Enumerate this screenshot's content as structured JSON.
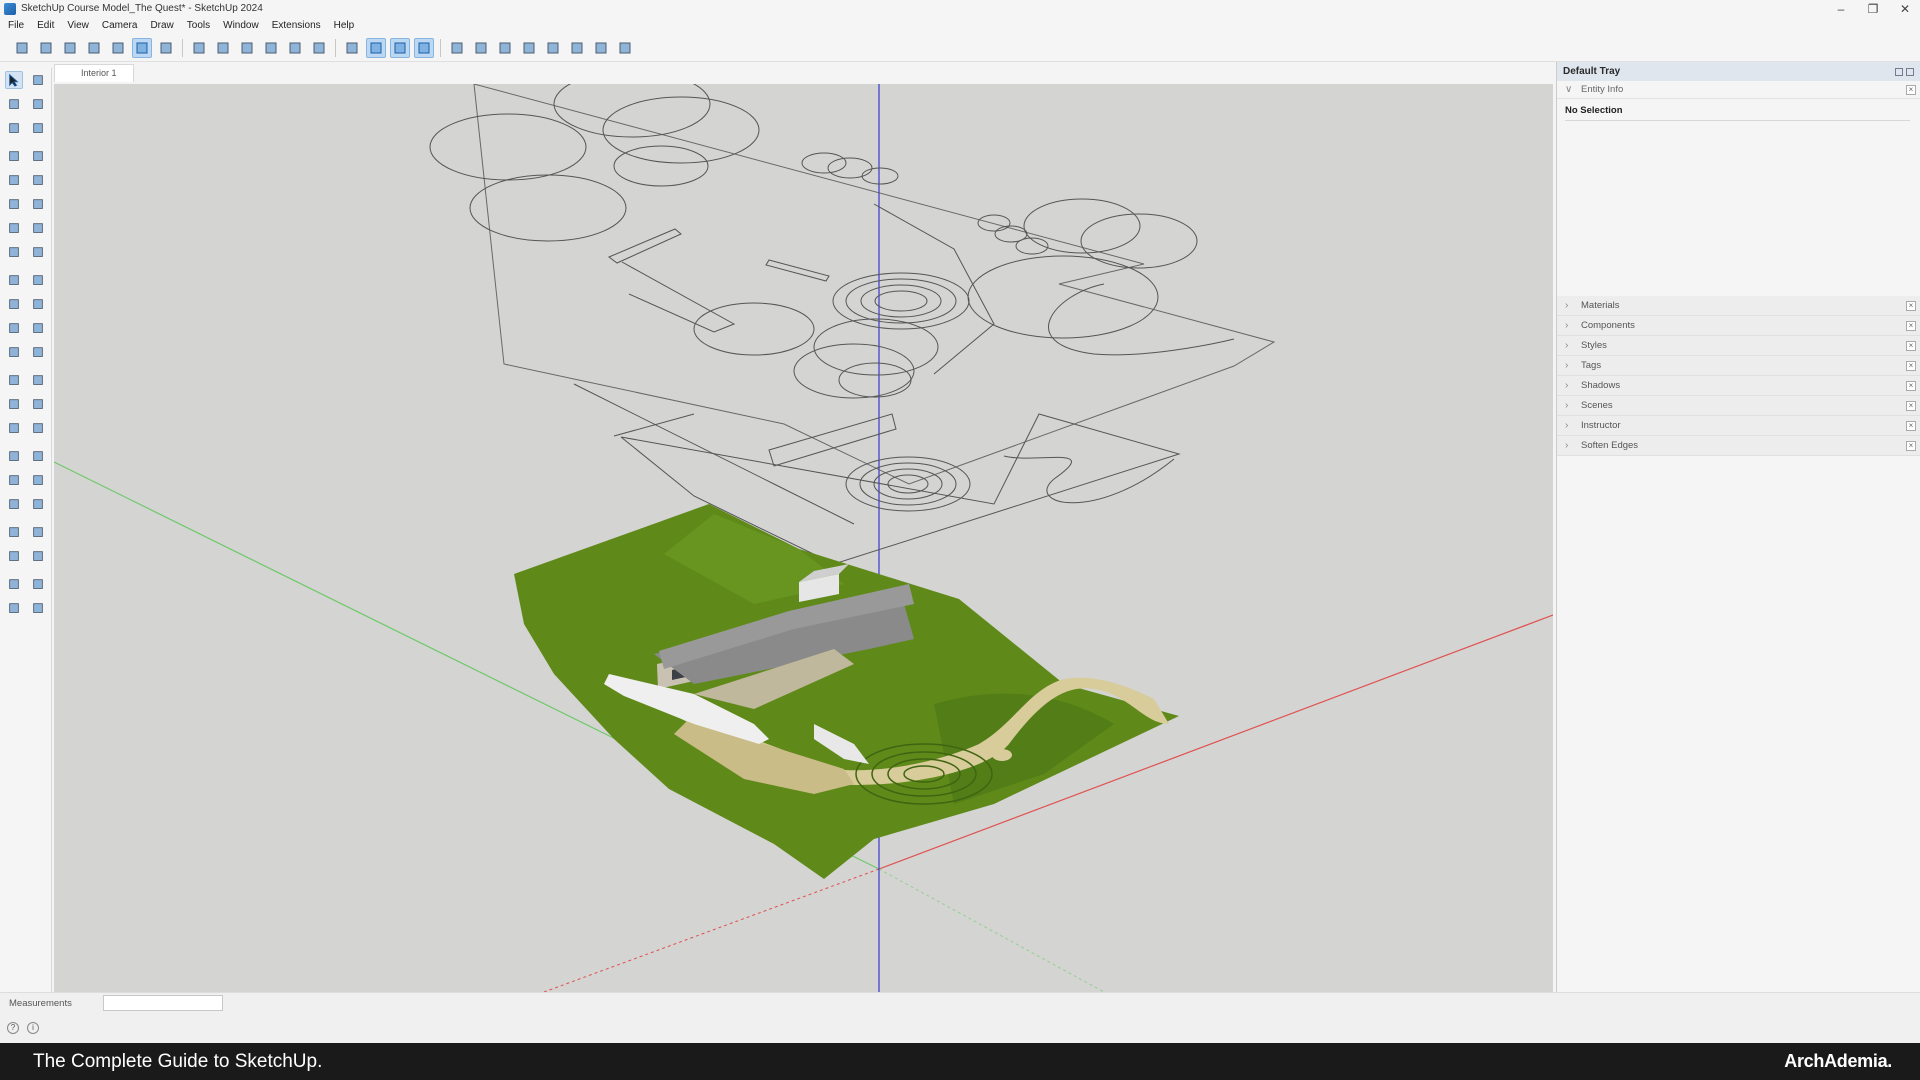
{
  "window": {
    "title": "SketchUp Course Model_The Quest* - SketchUp 2024",
    "controls": [
      "minimize-icon",
      "restore-icon",
      "close-icon"
    ]
  },
  "menu": [
    "File",
    "Edit",
    "View",
    "Camera",
    "Draw",
    "Tools",
    "Window",
    "Extensions",
    "Help"
  ],
  "toolbar": {
    "icons": [
      "xray-icon",
      "back-edges-icon",
      "wireframe-icon",
      "hidden-line-icon",
      "shaded-icon",
      "shaded-textures-icon",
      "monochrome-icon",
      "iso-view-icon",
      "top-view-icon",
      "front-view-icon",
      "right-view-icon",
      "back-view-icon",
      "left-view-icon",
      "section-plane-icon",
      "display-section-planes-icon",
      "display-section-cuts-icon",
      "section-fill-icon",
      "sandbox-contours-icon",
      "sandbox-scratch-icon",
      "smoove-icon",
      "stamp-icon",
      "drape-icon",
      "add-detail-icon",
      "flip-edge-icon",
      "tag-tool-icon"
    ],
    "active": [
      "shaded-textures-icon",
      "display-section-planes-icon",
      "display-section-cuts-icon",
      "section-fill-icon"
    ]
  },
  "left_tools": [
    [
      "select-icon",
      "lasso-icon"
    ],
    [
      "paint-bucket-icon",
      "eraser-icon"
    ],
    [
      "tag-icon",
      "eraser-soft-icon"
    ],
    [
      "pencil-icon",
      "freehand-icon"
    ],
    [
      "rectangle-icon",
      "rotated-rectangle-icon"
    ],
    [
      "circle-icon",
      "polygon-icon"
    ],
    [
      "arc-icon",
      "two-point-arc-icon"
    ],
    [
      "three-point-arc-icon",
      "pie-icon"
    ],
    [
      "move-icon",
      "push-pull-icon"
    ],
    [
      "rotate-icon",
      "follow-me-icon"
    ],
    [
      "scale-icon",
      "offset-icon"
    ],
    [
      "solid-tools-icon",
      "flip-icon"
    ],
    [
      "tape-measure-icon",
      "dimension-icon"
    ],
    [
      "protractor-icon",
      "text-icon"
    ],
    [
      "axes-icon",
      "3d-text-icon"
    ],
    [
      "orbit-icon",
      "pan-icon"
    ],
    [
      "zoom-icon",
      "zoom-window-icon"
    ],
    [
      "zoom-extents-icon",
      "previous-view-icon"
    ],
    [
      "position-camera-icon",
      "walk-icon"
    ],
    [
      "look-around-icon",
      "section-icon"
    ],
    [
      "warehouse-icon",
      "extension-icon"
    ],
    [
      "layers-icon",
      "styles-icon"
    ]
  ],
  "scene_tab": "Interior 1",
  "tray": {
    "title": "Default Tray",
    "entity_info_label": "Entity Info",
    "entity_info_value": "No Selection",
    "panels": [
      "Materials",
      "Components",
      "Styles",
      "Tags",
      "Shadows",
      "Scenes",
      "Instructor",
      "Soften Edges"
    ]
  },
  "measurements": {
    "label": "Measurements",
    "value": ""
  },
  "caption": {
    "text": "The Complete Guide to SketchUp.",
    "brand": "ArchAdemia."
  },
  "colors": {
    "viewport_bg": "#d4d4d2",
    "axis_red": "#e0504f",
    "axis_green": "#6fc96a",
    "axis_blue": "#3a3ad0",
    "grass": "#5f8a1a",
    "sand": "#d8cc9a",
    "roof": "#8a8a8a",
    "selection": "#bcd8f2"
  }
}
